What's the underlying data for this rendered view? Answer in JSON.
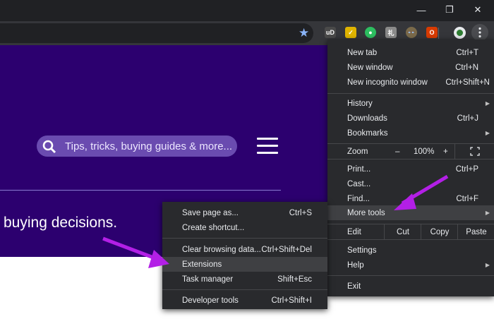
{
  "window_controls": {
    "minimize": "—",
    "restore": "❐",
    "close": "✕"
  },
  "hero": {
    "search_placeholder": "Tips, tricks, buying guides & more...",
    "tagline": "buying decisions."
  },
  "extensions": [
    {
      "name": "ublock-icon",
      "color": "#4a4a4a",
      "text": "uD"
    },
    {
      "name": "norton-icon",
      "color": "#e0b400",
      "text": "✓"
    },
    {
      "name": "evernote-icon",
      "color": "#2dbe60",
      "text": "●"
    },
    {
      "name": "translate-icon",
      "color": "#8a8a8a",
      "text": "礼"
    },
    {
      "name": "owl-icon",
      "color": "#7a6a4a",
      "text": "👓"
    },
    {
      "name": "office-icon",
      "color": "#d83b01",
      "text": "O"
    }
  ],
  "main_menu": {
    "new_tab": {
      "label": "New tab",
      "shortcut": "Ctrl+T"
    },
    "new_window": {
      "label": "New window",
      "shortcut": "Ctrl+N"
    },
    "new_incognito": {
      "label": "New incognito window",
      "shortcut": "Ctrl+Shift+N"
    },
    "history": {
      "label": "History"
    },
    "downloads": {
      "label": "Downloads",
      "shortcut": "Ctrl+J"
    },
    "bookmarks": {
      "label": "Bookmarks"
    },
    "zoom": {
      "label": "Zoom",
      "minus": "–",
      "level": "100%",
      "plus": "+"
    },
    "print": {
      "label": "Print...",
      "shortcut": "Ctrl+P"
    },
    "cast": {
      "label": "Cast..."
    },
    "find": {
      "label": "Find...",
      "shortcut": "Ctrl+F"
    },
    "more_tools": {
      "label": "More tools"
    },
    "edit": {
      "label": "Edit",
      "cut": "Cut",
      "copy": "Copy",
      "paste": "Paste"
    },
    "settings": {
      "label": "Settings"
    },
    "help": {
      "label": "Help"
    },
    "exit": {
      "label": "Exit"
    }
  },
  "sub_menu": {
    "save_page": {
      "label": "Save page as...",
      "shortcut": "Ctrl+S"
    },
    "create_shortcut": {
      "label": "Create shortcut..."
    },
    "clear_data": {
      "label": "Clear browsing data...",
      "shortcut": "Ctrl+Shift+Del"
    },
    "extensions": {
      "label": "Extensions"
    },
    "task_manager": {
      "label": "Task manager",
      "shortcut": "Shift+Esc"
    },
    "developer_tools": {
      "label": "Developer tools",
      "shortcut": "Ctrl+Shift+I"
    }
  },
  "colors": {
    "hero": "#2c006f",
    "annotation_arrow": "#b31fe6",
    "menu_bg": "#292a2d"
  }
}
